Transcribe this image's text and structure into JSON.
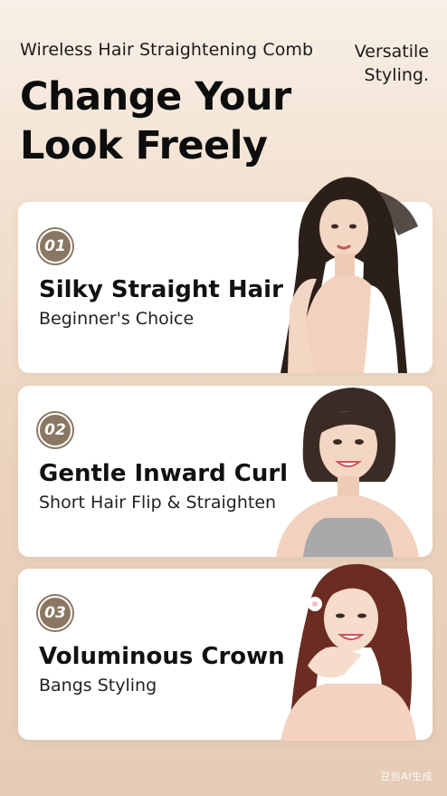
{
  "header": {
    "subtitle": "Wireless Hair Straightening Comb",
    "tagline_line1": "Versatile",
    "tagline_line2": "Styling.",
    "headline_line1": "Change Your",
    "headline_line2": "Look Freely"
  },
  "cards": [
    {
      "number": "01",
      "title": "Silky Straight Hair",
      "subtitle": "Beginner's Choice"
    },
    {
      "number": "02",
      "title": "Gentle Inward Curl",
      "subtitle": "Short Hair Flip & Straighten"
    },
    {
      "number": "03",
      "title": "Voluminous Crown",
      "subtitle": "Bangs Styling"
    }
  ],
  "watermark": "豆包AI生成",
  "colors": {
    "badge": "#8a7763",
    "card_bg": "#ffffff",
    "background": "#f1dfcd"
  }
}
